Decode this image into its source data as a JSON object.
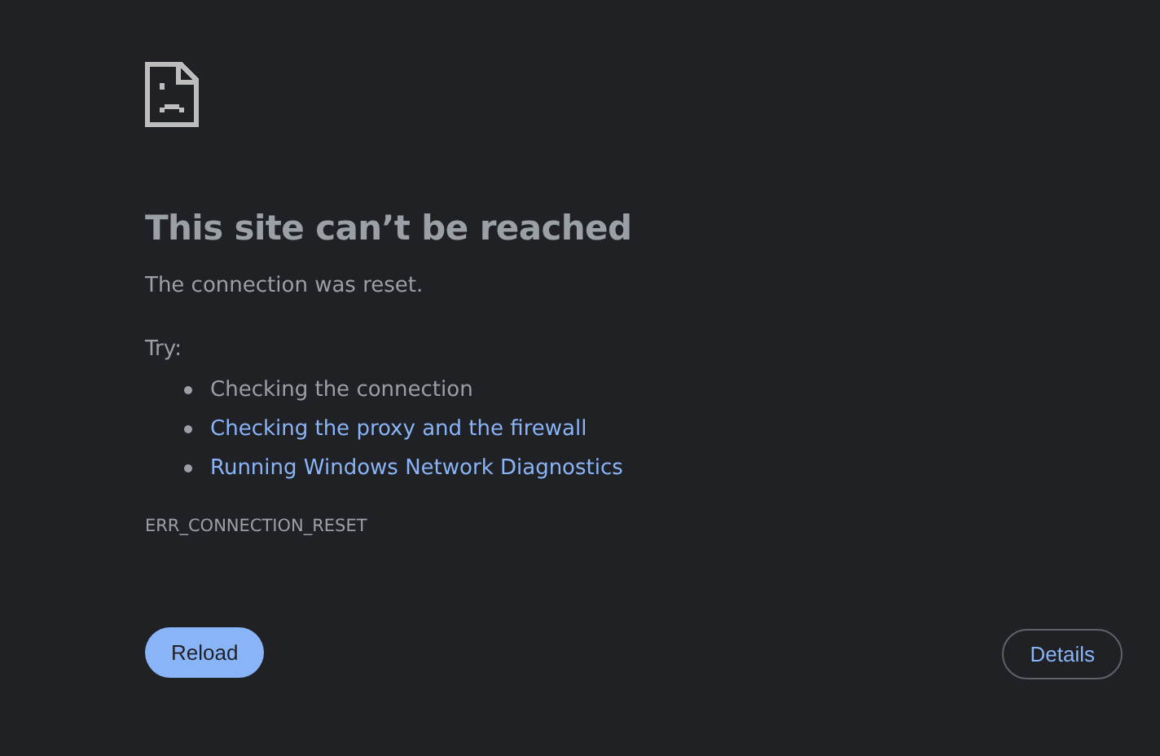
{
  "heading": "This site can’t be reached",
  "message": "The connection was reset.",
  "try_label": "Try:",
  "suggestions": [
    {
      "kind": "text",
      "text": "Checking the connection"
    },
    {
      "kind": "link",
      "text": "Checking the proxy and the firewall"
    },
    {
      "kind": "link",
      "text": "Running Windows Network Diagnostics"
    }
  ],
  "error_code": "ERR_CONNECTION_RESET",
  "buttons": [
    {
      "kind": "primary",
      "label": "Reload"
    },
    {
      "kind": "secondary",
      "label": "Details"
    }
  ]
}
